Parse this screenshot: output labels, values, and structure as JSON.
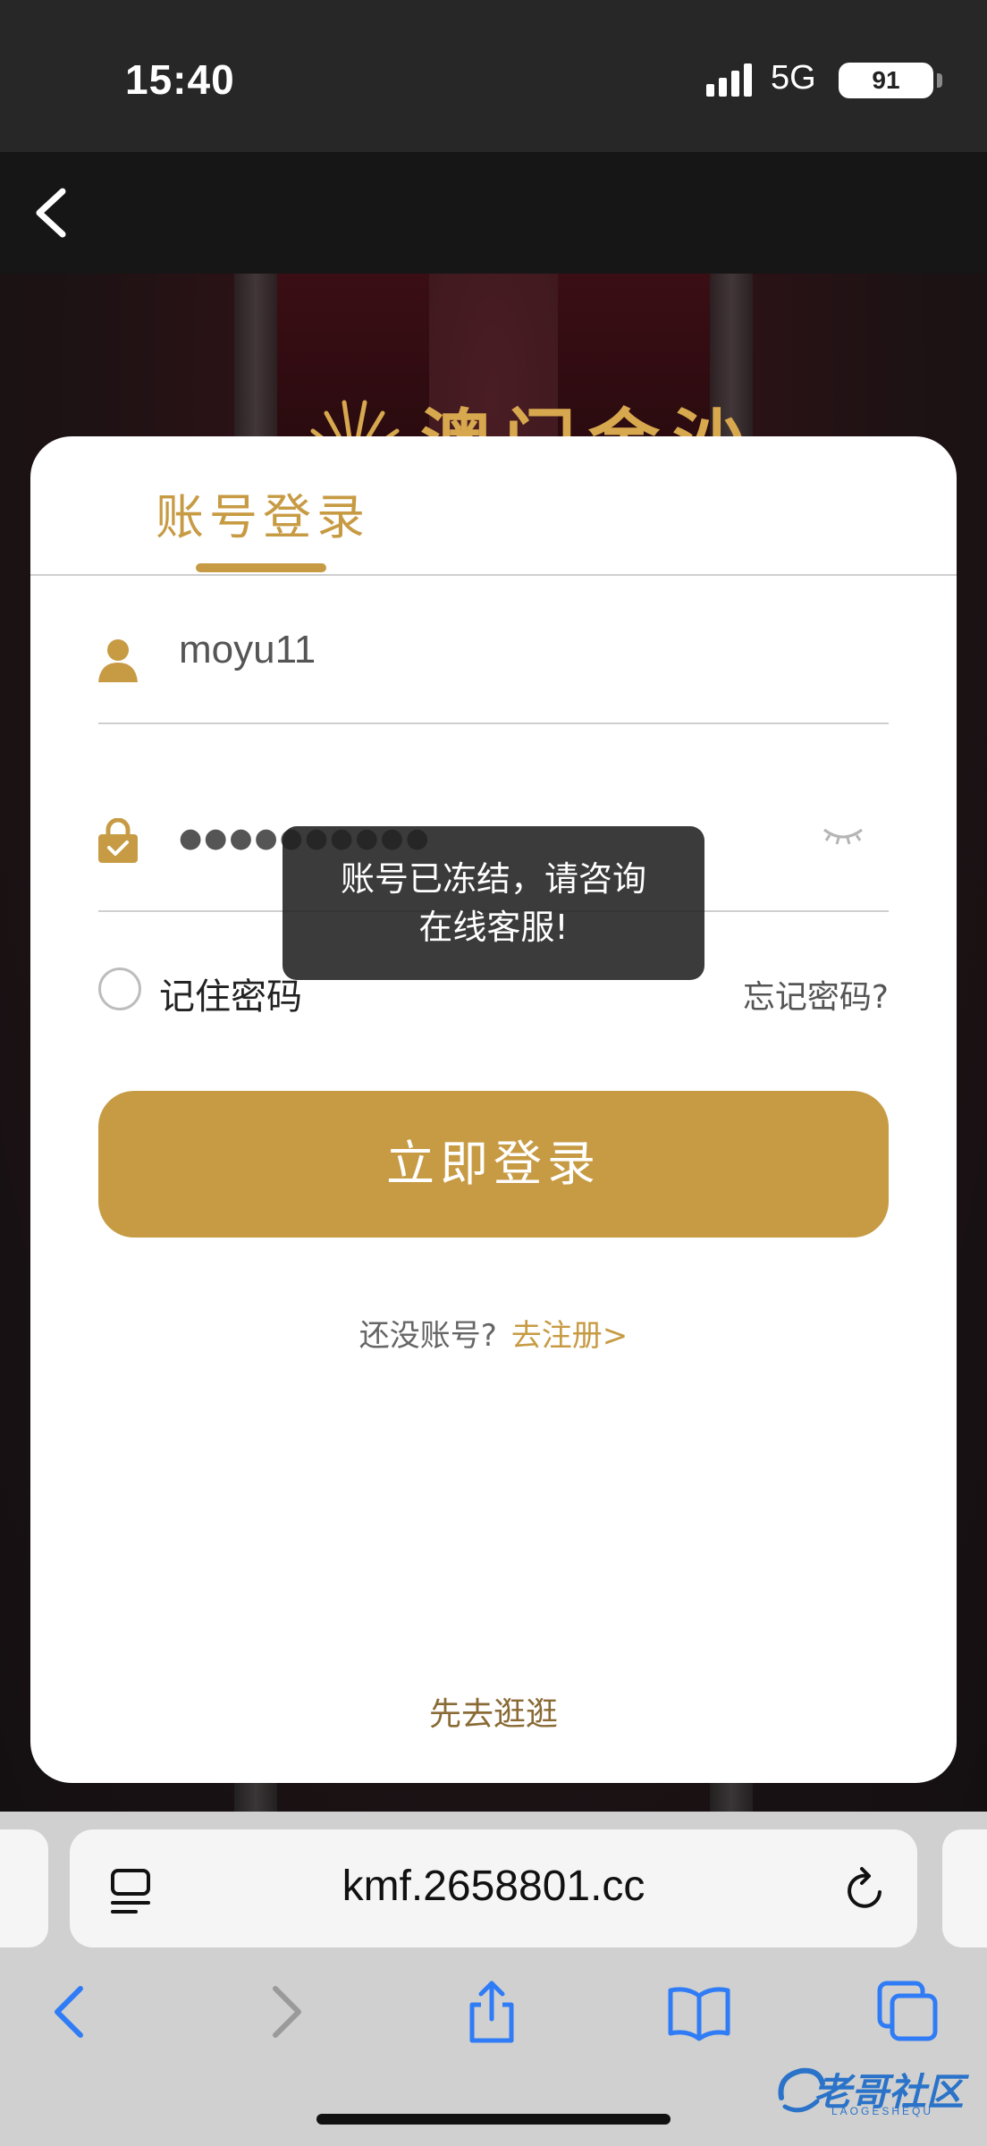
{
  "status_bar": {
    "time": "15:40",
    "network": "5G",
    "battery": "91"
  },
  "hero": {
    "logo_text": "澳门金沙"
  },
  "login": {
    "tab_label": "账号登录",
    "username": "moyu11",
    "password_mask": "●●●●●●●●●●",
    "remember_label": "记住密码",
    "forgot_label": "忘记密码?",
    "submit_label": "立即登录",
    "register_prompt": "还没账号?",
    "register_link": "去注册>",
    "browse_label": "先去逛逛"
  },
  "toast": {
    "line1": "账号已冻结，请咨询",
    "line2": "在线客服!"
  },
  "browser": {
    "url": "kmf.2658801.cc"
  },
  "watermark": {
    "text": "老哥社区",
    "sub": "LAOGESHEQU"
  },
  "colors": {
    "accent": "#c79b44",
    "status_bar": "#272727",
    "nav_bar": "#161616",
    "card": "#ffffff",
    "toast_bg": "#202020",
    "browser_chrome": "#d0d0d0",
    "browser_icon": "#2f7cf6"
  },
  "icons": {
    "back": "chevron-left-icon",
    "user": "user-icon",
    "lock": "lock-icon",
    "eye": "eye-closed-icon",
    "reader": "reader-icon",
    "reload": "reload-icon",
    "toolbar": [
      "back-arrow-icon",
      "forward-arrow-icon",
      "share-icon",
      "bookmarks-icon",
      "tabs-icon"
    ]
  }
}
